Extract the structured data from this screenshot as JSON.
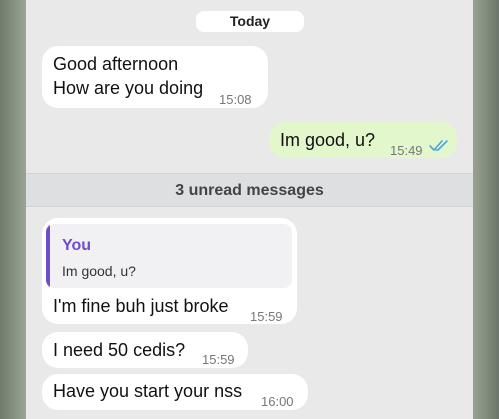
{
  "chat": {
    "date_label": "Today",
    "unread_label": "3 unread messages",
    "messages": [
      {
        "direction": "incoming",
        "lines": [
          "Good afternoon",
          "How are you doing"
        ],
        "time": "15:08"
      },
      {
        "direction": "outgoing",
        "text": "Im good, u?",
        "time": "15:49",
        "status_icon": "double-check-read-icon"
      },
      {
        "direction": "incoming",
        "reply_to": {
          "author": "You",
          "text": "Im good, u?"
        },
        "text": "I'm fine buh just broke",
        "time": "15:59"
      },
      {
        "direction": "incoming",
        "text": "I need 50 cedis?",
        "time": "15:59"
      },
      {
        "direction": "incoming",
        "text": "Have you start your nss",
        "time": "16:00"
      }
    ]
  },
  "colors": {
    "chat_background": "#e9e9ea",
    "incoming_bubble": "#ffffff",
    "outgoing_bubble": "#e2f7cb",
    "reply_accent": "#6f4ccb",
    "read_tick": "#4fa3e0"
  }
}
